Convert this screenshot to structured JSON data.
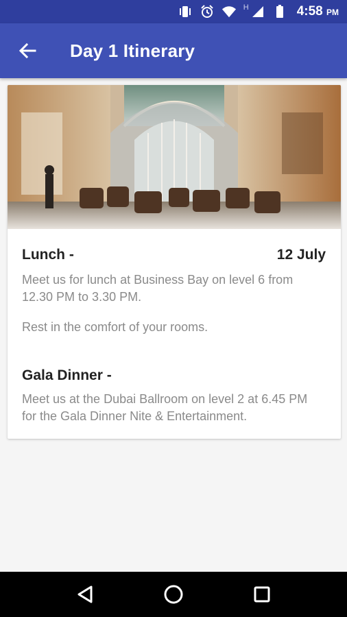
{
  "status_bar": {
    "time": "4:58",
    "ampm": "PM",
    "network_label": "H",
    "icons": [
      "vibrate-icon",
      "alarm-icon",
      "wifi-icon",
      "signal-icon",
      "battery-icon"
    ]
  },
  "app_bar": {
    "title": "Day 1 Itinerary",
    "back_icon": "arrow-back-icon",
    "color": "#3f51b5"
  },
  "card": {
    "image_alt": "Hotel atrium lounge with glass dome ceiling",
    "sections": [
      {
        "title": "Lunch -",
        "date": "12 July",
        "paragraphs": [
          "Meet us for lunch at Business Bay on level 6 from 12.30 PM to 3.30 PM.",
          "Rest in the comfort of your rooms."
        ]
      },
      {
        "title": "Gala Dinner -",
        "date": "",
        "paragraphs": [
          "Meet us at the Dubai Ballroom on level 2 at 6.45 PM for the Gala Dinner Nite & Entertainment."
        ]
      }
    ]
  },
  "nav_bar": {
    "icons": [
      "back-triangle-icon",
      "home-circle-icon",
      "recents-square-icon"
    ]
  }
}
